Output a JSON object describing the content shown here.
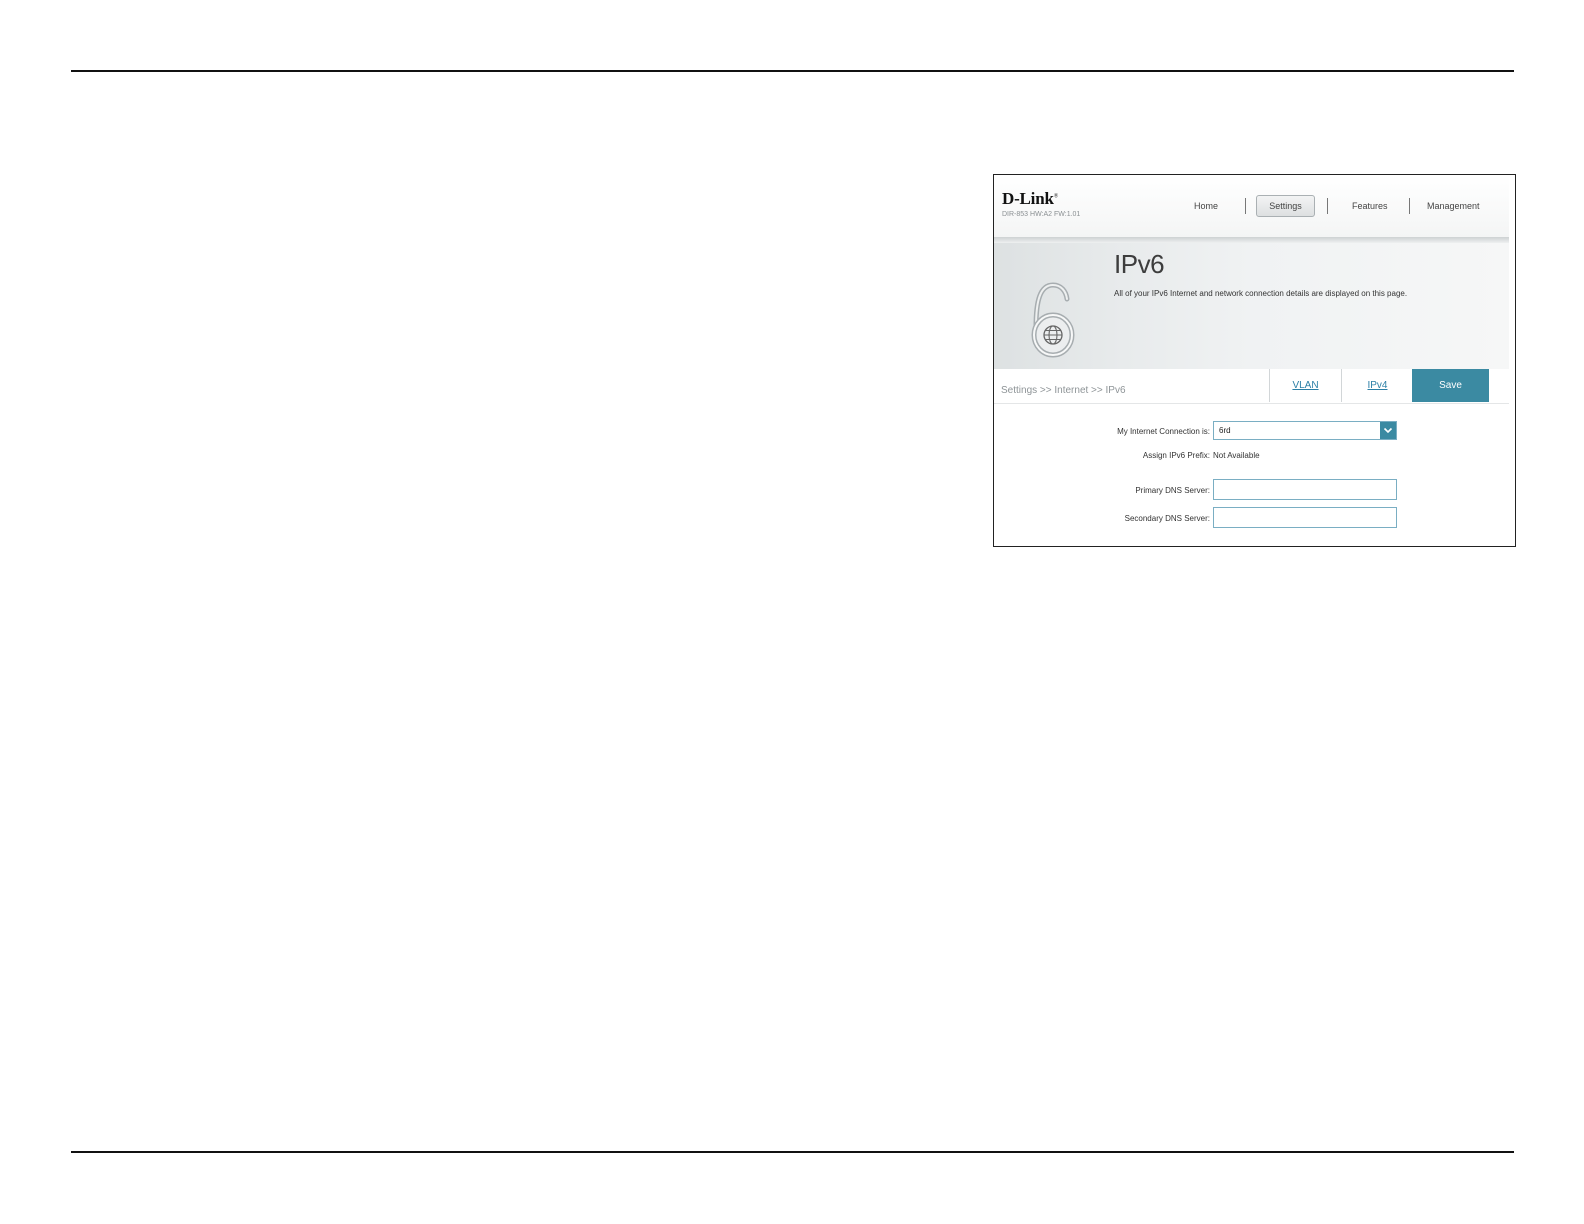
{
  "router": {
    "brand": "D-Link",
    "model": "DIR-853 HW:A2 FW:1.01",
    "nav": {
      "home": "Home",
      "settings": "Settings",
      "features": "Features",
      "management": "Management",
      "active": "Settings"
    },
    "page": {
      "title": "IPv6",
      "description": "All of your IPv6 Internet and network connection details are displayed on this page."
    },
    "breadcrumb": "Settings >> Internet >> IPv6",
    "tabs": {
      "vlan": "VLAN",
      "ipv4": "IPv4"
    },
    "save_label": "Save",
    "form": {
      "connection_label": "My Internet Connection is:",
      "connection_value": "6rd",
      "prefix_label": "Assign IPv6 Prefix:",
      "prefix_value": "Not Available",
      "primary_dns_label": "Primary DNS Server:",
      "primary_dns_value": "",
      "secondary_dns_label": "Secondary DNS Server:",
      "secondary_dns_value": ""
    },
    "colors": {
      "accent": "#3b8aa2",
      "link": "#2b7fa6"
    }
  }
}
